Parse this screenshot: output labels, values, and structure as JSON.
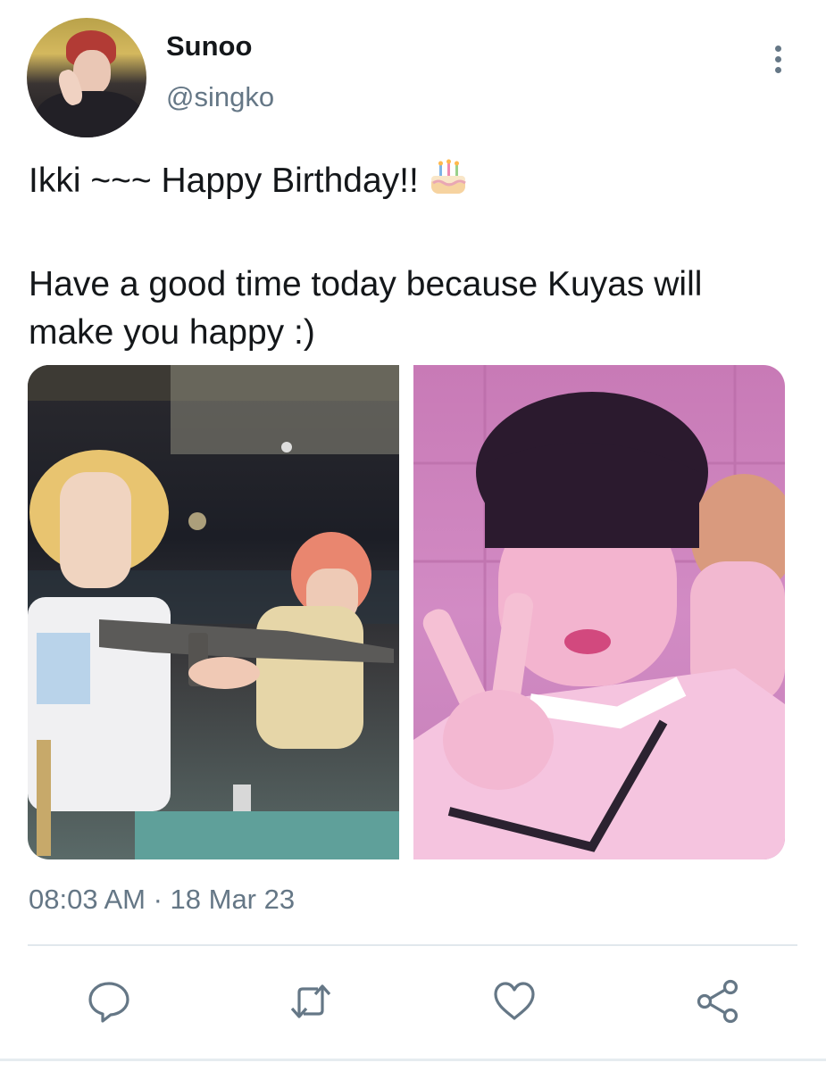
{
  "tweet": {
    "display_name": "Sunoo",
    "handle": "@singko",
    "text_line1": "Ikki ~~~ Happy Birthday!!",
    "text_para2": "Have a good time today because Kuyas will make you happy :)",
    "emoji": "birthday-cake",
    "timestamp": "08:03 AM · 18 Mar 23"
  },
  "icons": {
    "more": "more-vertical-icon",
    "reply": "reply-icon",
    "retweet": "retweet-icon",
    "like": "heart-icon",
    "share": "share-icon"
  },
  "colors": {
    "text": "#14171a",
    "secondary": "#657786",
    "divider": "#e1e8ed"
  }
}
